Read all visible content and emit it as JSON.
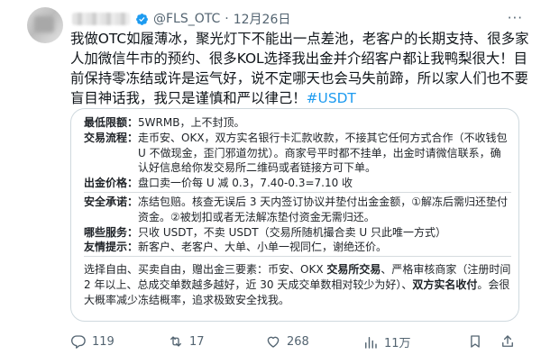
{
  "post": {
    "handle": "@FLS_OTC",
    "dot": "·",
    "date": "12月26日",
    "more": "···",
    "text_main": "我做OTC如履薄冰，聚光灯下不能出一点差池，老客户的长期支持、很多家人加微信牛市的预约、很多KOL选择我出金并介绍客户都让我鸭梨很大！目前保持零冻结或许是运气好，说不定哪天也会马失前蹄，所以家人们也不要盲目神话我，我只是谨慎和严以律己！",
    "hashtag": "#USDT"
  },
  "card": {
    "rows_top": [
      {
        "label": "最低限额：",
        "value": "5WRMB，上不封顶。"
      },
      {
        "label": "交易流程：",
        "value": "走币安、OKX，双方实名银行卡汇款收款，不接其它任何方式合作（不收钱包 U 不做现金，歪门邪道勿扰）。商家号平时都不挂单，出金时请微信联系，确认好信息给你发交易所二维码或者链接方可下单。"
      },
      {
        "label": "出金价格：",
        "value": "盘口卖一价每 U 减 0.3，7.40-0.3=7.10 收"
      }
    ],
    "rows_bottom": [
      {
        "label": "安全承诺：",
        "value": "冻结包赔。核查无误后 3 天内签订协议并垫付出金金额，①解冻后需归还垫付资金。②被划扣或者无法解冻垫付资金无需归还。"
      },
      {
        "label": "哪些服务：",
        "value": "只收 USDT，不卖 USDT（交易所随机撮合卖 U 只此唯一方式）"
      },
      {
        "label": "友情提示：",
        "value": "新客户、老客户、大单、小单一视同仁，谢绝还价。"
      }
    ],
    "para_a": "选择自由、买卖自由，赠出金三要素：币安、OKX ",
    "para_b1": "交易所交易",
    "para_c": "、严格审核商家（注册时间 2 年以上、总成交单数越多越好，近 30 天成交单数相对较少为好）、",
    "para_b2": "双方实名收付",
    "para_d": "。会很大概率减少冻结概率，追求极致安全找我。"
  },
  "actions": {
    "reply_count": "119",
    "repost_count": "17",
    "like_count": "268",
    "view_count": "11万"
  },
  "colors": {
    "link": "#1d9bf0",
    "text": "#0f1419",
    "muted": "#536471",
    "border": "#cfd9de"
  }
}
